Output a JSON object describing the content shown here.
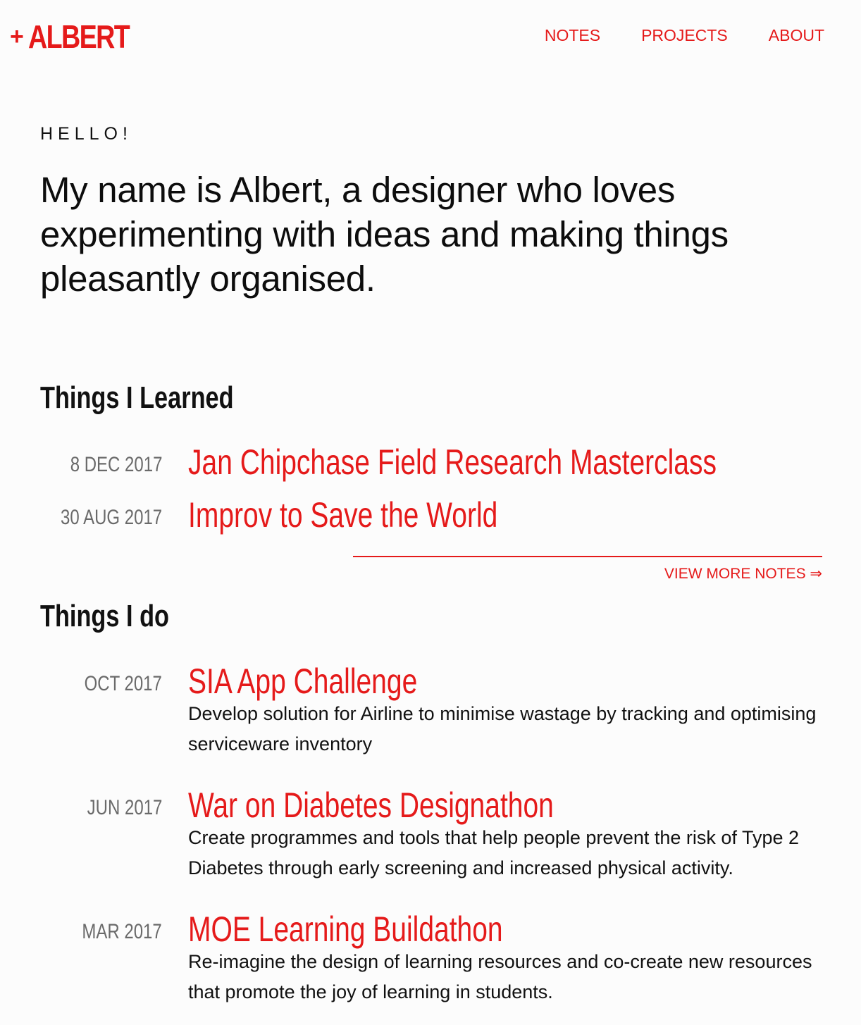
{
  "header": {
    "logo_plus": "+",
    "logo_name": "ALBERT",
    "nav": [
      {
        "label": "NOTES"
      },
      {
        "label": "PROJECTS"
      },
      {
        "label": "ABOUT"
      }
    ]
  },
  "intro": {
    "greeting": "HELLO!",
    "text": "My name is Albert, a designer who loves experimenting with ideas and making things pleasantly organised."
  },
  "learned": {
    "title": "Things I Learned",
    "items": [
      {
        "date": "8 DEC 2017",
        "title": "Jan Chipchase Field Research Masterclass"
      },
      {
        "date": "30 AUG 2017",
        "title": "Improv to Save the World"
      }
    ],
    "view_more": "VIEW MORE NOTES ⇒"
  },
  "projects": {
    "title": "Things I do",
    "items": [
      {
        "date": "OCT 2017",
        "title": "SIA App Challenge",
        "desc": "Develop solution for Airline to minimise wastage by tracking and optimising serviceware inventory"
      },
      {
        "date": "JUN 2017",
        "title": "War on Diabetes Designathon",
        "desc": "Create programmes and tools that help people prevent the risk of Type 2 Diabetes through early screening and increased physical activity."
      },
      {
        "date": "MAR 2017",
        "title": "MOE Learning Buildathon",
        "desc": "Re-imagine the design of learning resources and co-create new resources that promote the joy of learning in students."
      }
    ]
  },
  "colors": {
    "accent": "#e51a1a",
    "text": "#111111",
    "muted": "#6a6a6a",
    "background": "#fcfcfc"
  }
}
